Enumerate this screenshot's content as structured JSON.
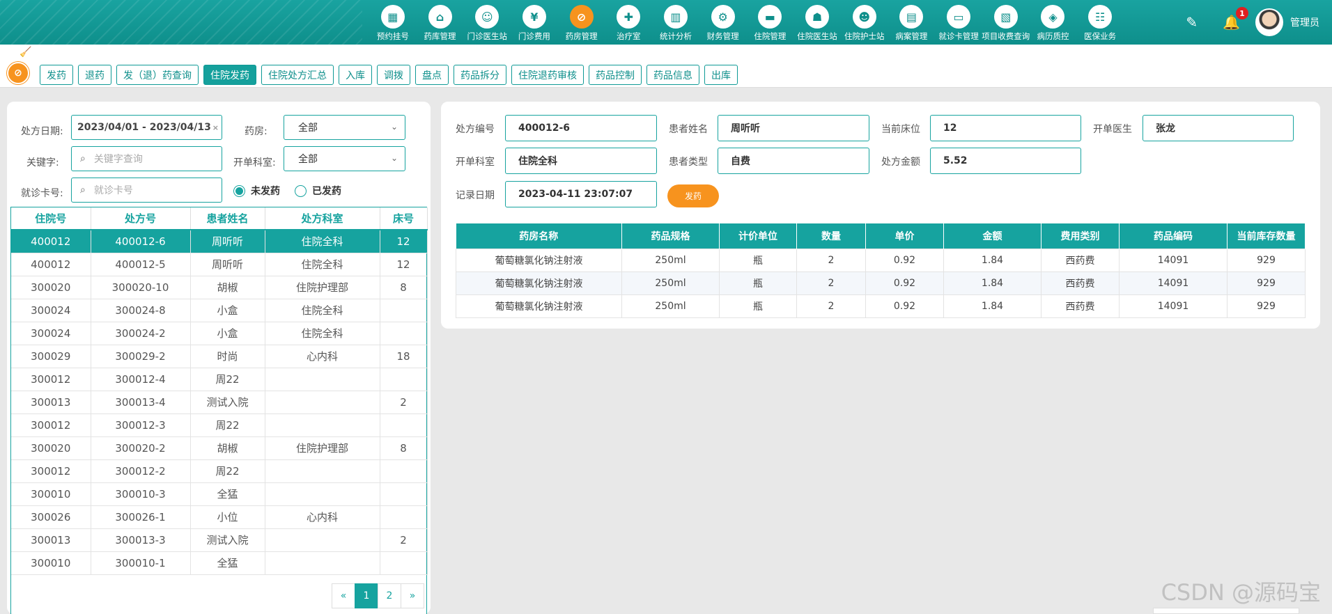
{
  "nav": [
    {
      "label": "预约挂号",
      "icon": "registration-icon",
      "glyph": "▦"
    },
    {
      "label": "药库管理",
      "icon": "warehouse-icon",
      "glyph": "⌂"
    },
    {
      "label": "门诊医生站",
      "icon": "doctor-icon",
      "glyph": "☺"
    },
    {
      "label": "门诊费用",
      "icon": "yen-icon",
      "glyph": "¥"
    },
    {
      "label": "药房管理",
      "icon": "pill-icon",
      "glyph": "⊘",
      "active": true
    },
    {
      "label": "治疗室",
      "icon": "nurse-icon",
      "glyph": "✚"
    },
    {
      "label": "统计分析",
      "icon": "chart-icon",
      "glyph": "▥"
    },
    {
      "label": "财务管理",
      "icon": "finance-icon",
      "glyph": "⚙"
    },
    {
      "label": "住院管理",
      "icon": "bed-icon",
      "glyph": "▬"
    },
    {
      "label": "住院医生站",
      "icon": "inpatient-doctor-icon",
      "glyph": "☗"
    },
    {
      "label": "住院护士站",
      "icon": "inpatient-nurse-icon",
      "glyph": "☻"
    },
    {
      "label": "病案管理",
      "icon": "record-icon",
      "glyph": "▤"
    },
    {
      "label": "就诊卡管理",
      "icon": "card-icon",
      "glyph": "▭"
    },
    {
      "label": "项目收费查询",
      "icon": "fee-query-icon",
      "glyph": "▧"
    },
    {
      "label": "病历质控",
      "icon": "quality-icon",
      "glyph": "◈"
    },
    {
      "label": "医保业务",
      "icon": "insurance-icon",
      "glyph": "☷"
    }
  ],
  "header": {
    "user": "管理员",
    "notifications": "1"
  },
  "tabs": [
    {
      "label": "发药"
    },
    {
      "label": "退药"
    },
    {
      "label": "发（退）药查询"
    },
    {
      "label": "住院发药",
      "active": true
    },
    {
      "label": "住院处方汇总"
    },
    {
      "label": "入库"
    },
    {
      "label": "调拨"
    },
    {
      "label": "盘点"
    },
    {
      "label": "药品拆分"
    },
    {
      "label": "住院退药审核"
    },
    {
      "label": "药品控制"
    },
    {
      "label": "药品信息"
    },
    {
      "label": "出库"
    }
  ],
  "filters": {
    "date_label": "处方日期:",
    "date_value": "2023/04/01 - 2023/04/13",
    "pharmacy_label": "药房:",
    "pharmacy_value": "全部",
    "keyword_label": "关键字:",
    "keyword_placeholder": "关键字查询",
    "dept_label": "开单科室:",
    "dept_value": "全部",
    "card_label": "就诊卡号:",
    "card_placeholder": "就诊卡号",
    "radio_pending": "未发药",
    "radio_done": "已发药"
  },
  "left_table": {
    "headers": [
      "住院号",
      "处方号",
      "患者姓名",
      "处方科室",
      "床号"
    ],
    "rows": [
      [
        "400012",
        "400012-6",
        "周听听",
        "住院全科",
        "12"
      ],
      [
        "400012",
        "400012-5",
        "周听听",
        "住院全科",
        "12"
      ],
      [
        "300020",
        "300020-10",
        "胡椒",
        "住院护理部",
        "8"
      ],
      [
        "300024",
        "300024-8",
        "小盒",
        "住院全科",
        ""
      ],
      [
        "300024",
        "300024-2",
        "小盒",
        "住院全科",
        ""
      ],
      [
        "300029",
        "300029-2",
        "时尚",
        "心内科",
        "18"
      ],
      [
        "300012",
        "300012-4",
        "周22",
        "",
        ""
      ],
      [
        "300013",
        "300013-4",
        "测试入院",
        "",
        "2"
      ],
      [
        "300012",
        "300012-3",
        "周22",
        "",
        ""
      ],
      [
        "300020",
        "300020-2",
        "胡椒",
        "住院护理部",
        "8"
      ],
      [
        "300012",
        "300012-2",
        "周22",
        "",
        ""
      ],
      [
        "300010",
        "300010-3",
        "全猛",
        "",
        ""
      ],
      [
        "300026",
        "300026-1",
        "小位",
        "心内科",
        ""
      ],
      [
        "300013",
        "300013-3",
        "测试入院",
        "",
        "2"
      ],
      [
        "300010",
        "300010-1",
        "全猛",
        "",
        ""
      ]
    ]
  },
  "pager": {
    "prev": "«",
    "pages": [
      "1",
      "2"
    ],
    "next": "»"
  },
  "detail": {
    "rx_no_label": "处方编号",
    "rx_no": "400012-6",
    "patient_label": "患者姓名",
    "patient": "周听听",
    "bed_label": "当前床位",
    "bed": "12",
    "doctor_label": "开单医生",
    "doctor": "张龙",
    "dept_label": "开单科室",
    "dept": "住院全科",
    "ptype_label": "患者类型",
    "ptype": "自费",
    "amount_label": "处方金额",
    "amount": "5.52",
    "date_label": "记录日期",
    "date": "2023-04-11 23:07:07",
    "dispense_btn": "发药"
  },
  "drug_table": {
    "headers": [
      "药房名称",
      "药品规格",
      "计价单位",
      "数量",
      "单价",
      "金额",
      "费用类别",
      "药品编码",
      "当前库存数量"
    ],
    "rows": [
      [
        "葡萄糖氯化钠注射液",
        "250ml",
        "瓶",
        "2",
        "0.92",
        "1.84",
        "西药费",
        "14091",
        "929"
      ],
      [
        "葡萄糖氯化钠注射液",
        "250ml",
        "瓶",
        "2",
        "0.92",
        "1.84",
        "西药费",
        "14091",
        "929"
      ],
      [
        "葡萄糖氯化钠注射液",
        "250ml",
        "瓶",
        "2",
        "0.92",
        "1.84",
        "西药费",
        "14091",
        "929"
      ]
    ]
  },
  "watermark": "CSDN @源码宝",
  "colors": {
    "primary": "#16a39f",
    "accent": "#f7931e"
  }
}
